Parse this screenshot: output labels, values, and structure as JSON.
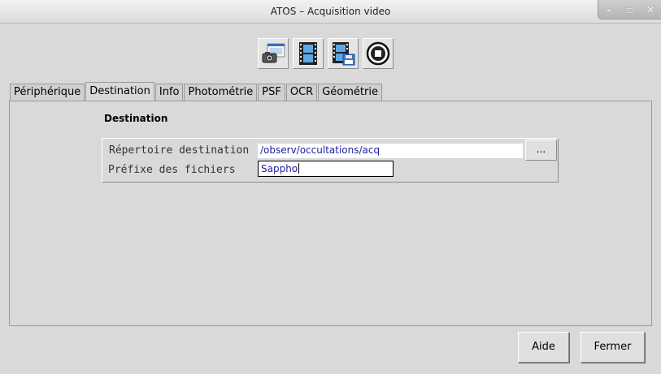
{
  "window": {
    "title": "ATOS – Acquisition video",
    "controls": {
      "minimize": "–",
      "maximize": "▫",
      "close": "✕"
    }
  },
  "toolbar": {
    "buttons": [
      "camera-config-icon",
      "video-film-icon",
      "video-save-icon",
      "stop-icon"
    ]
  },
  "tabs": [
    "Périphérique",
    "Destination",
    "Info",
    "Photométrie",
    "PSF",
    "OCR",
    "Géométrie"
  ],
  "active_tab": "Destination",
  "destination": {
    "title": "Destination",
    "dir_label": "Répertoire destination",
    "dir_value": "/observ/occultations/acq",
    "browse_label": "...",
    "prefix_label": "Préfixe des fichiers",
    "prefix_value": "Sappho"
  },
  "footer": {
    "help_label": "Aide",
    "close_label": "Fermer"
  }
}
